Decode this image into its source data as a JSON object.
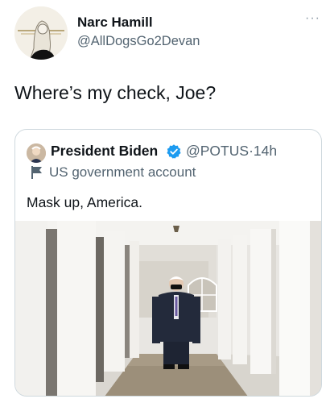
{
  "tweet": {
    "author_name": "Narc Hamill",
    "author_handle": "@AllDogsGo2Devan",
    "more_icon": "···",
    "text": "Where’s my check, Joe?"
  },
  "quoted_tweet": {
    "author_name": "President Biden",
    "author_handle": "@POTUS",
    "separator": "·",
    "timestamp": "14h",
    "account_label": "US government account",
    "text": "Mask up, America.",
    "verified_color": "#1d9bf0"
  }
}
